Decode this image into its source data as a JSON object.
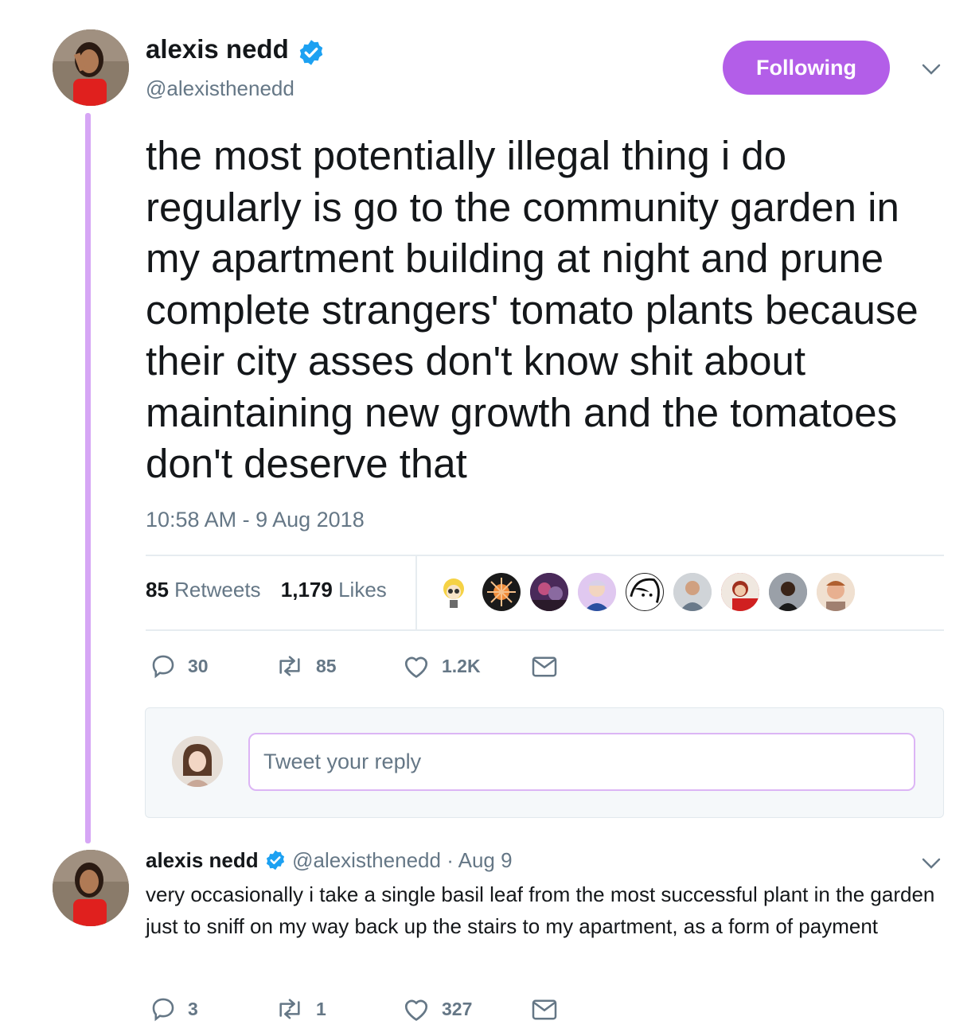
{
  "main_tweet": {
    "author": {
      "name": "alexis nedd",
      "handle": "@alexisthenedd"
    },
    "follow_label": "Following",
    "text": "the most potentially illegal thing i do regularly is go to the community garden in my apartment building at night and prune complete strangers' tomato plants because their city asses don't know shit about maintaining new growth and the tomatoes don't deserve that",
    "timestamp": "10:58 AM - 9 Aug 2018",
    "stats": {
      "retweets_count": "85",
      "retweets_label": "Retweets",
      "likes_count": "1,179",
      "likes_label": "Likes"
    },
    "liker_avatar_count": 9,
    "actions": {
      "replies": "30",
      "retweets": "85",
      "likes": "1.2K"
    }
  },
  "reply_composer": {
    "placeholder": "Tweet your reply"
  },
  "reply_tweet": {
    "author": {
      "name": "alexis nedd",
      "handle": "@alexisthenedd"
    },
    "date": "· Aug 9",
    "text": "very occasionally i take a single basil leaf from the most successful plant in the garden just to sniff on my way back up the stairs to my apartment, as a form of payment",
    "actions": {
      "replies": "3",
      "retweets": "1",
      "likes": "327"
    }
  },
  "colors": {
    "accent": "#b35ee8",
    "thread_line": "#d6a6f5",
    "verified": "#1da1f2",
    "secondary_text": "#657786"
  },
  "icons": [
    "verified-badge-icon",
    "chevron-down-icon",
    "reply-icon",
    "retweet-icon",
    "like-icon",
    "message-icon"
  ]
}
